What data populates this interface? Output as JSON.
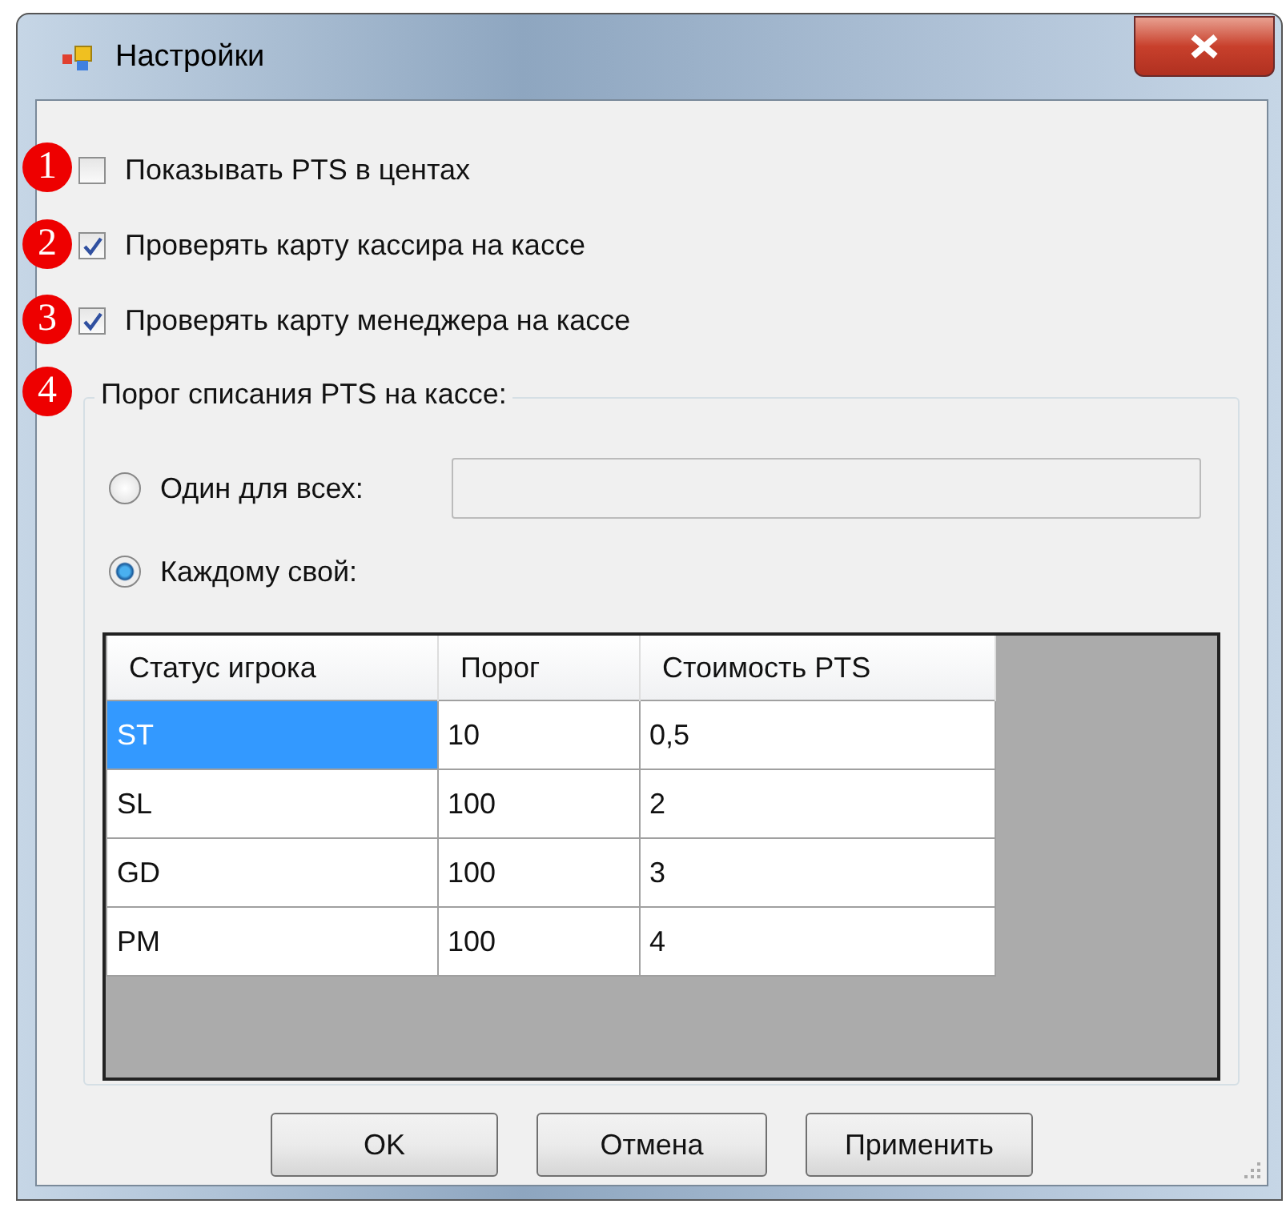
{
  "window": {
    "title": "Настройки"
  },
  "checkboxes": [
    {
      "label": "Показывать PTS в центах",
      "checked": false
    },
    {
      "label": "Проверять карту кассира на кассе",
      "checked": true
    },
    {
      "label": "Проверять карту менеджера на кассе",
      "checked": true
    }
  ],
  "group": {
    "label": "Порог списания PTS на кассе:",
    "options": [
      {
        "label": "Один для всех:",
        "selected": false
      },
      {
        "label": "Каждому свой:",
        "selected": true
      }
    ]
  },
  "table": {
    "columns": [
      "Статус игрока",
      "Порог",
      "Стоимость PTS"
    ],
    "rows": [
      {
        "cells": [
          "ST",
          "10",
          "0,5"
        ],
        "selected": true
      },
      {
        "cells": [
          "SL",
          "100",
          "2"
        ],
        "selected": false
      },
      {
        "cells": [
          "GD",
          "100",
          "3"
        ],
        "selected": false
      },
      {
        "cells": [
          "PM",
          "100",
          "4"
        ],
        "selected": false
      }
    ]
  },
  "buttons": [
    "OK",
    "Отмена",
    "Применить"
  ],
  "callouts": [
    "1",
    "2",
    "3",
    "4"
  ]
}
